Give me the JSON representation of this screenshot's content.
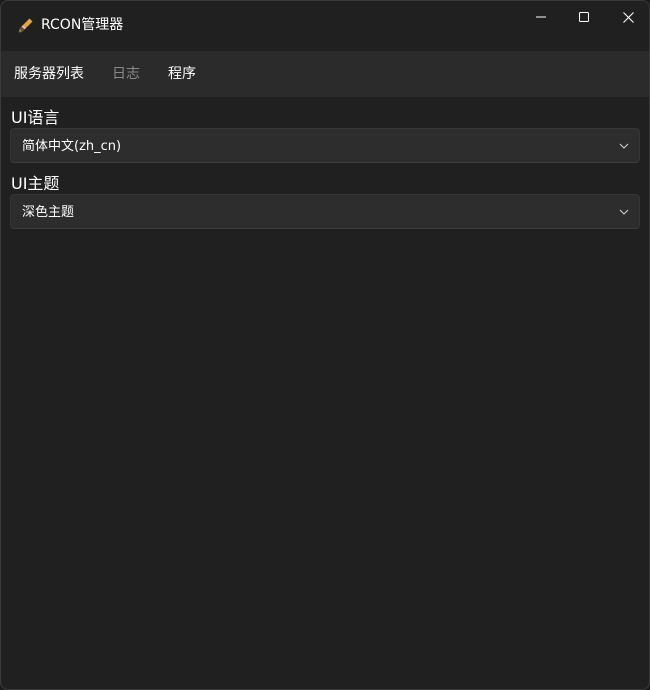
{
  "window": {
    "title": "RCON管理器",
    "app_icon": "brush-icon",
    "controls": {
      "minimize": "minimize-icon",
      "maximize": "maximize-icon",
      "close": "close-icon"
    }
  },
  "nav": {
    "items": [
      {
        "label": "服务器列表",
        "enabled": true
      },
      {
        "label": "日志",
        "enabled": false
      },
      {
        "label": "程序",
        "enabled": true
      }
    ]
  },
  "settings": {
    "language": {
      "label": "UI语言",
      "selected": "简体中文(zh_cn)"
    },
    "theme": {
      "label": "UI主题",
      "selected": "深色主题"
    }
  },
  "colors": {
    "background": "#202020",
    "navbar": "#2b2b2b",
    "combo": "#2d2d2d",
    "text": "#ffffff",
    "disabled_text": "#8a8a8a"
  }
}
